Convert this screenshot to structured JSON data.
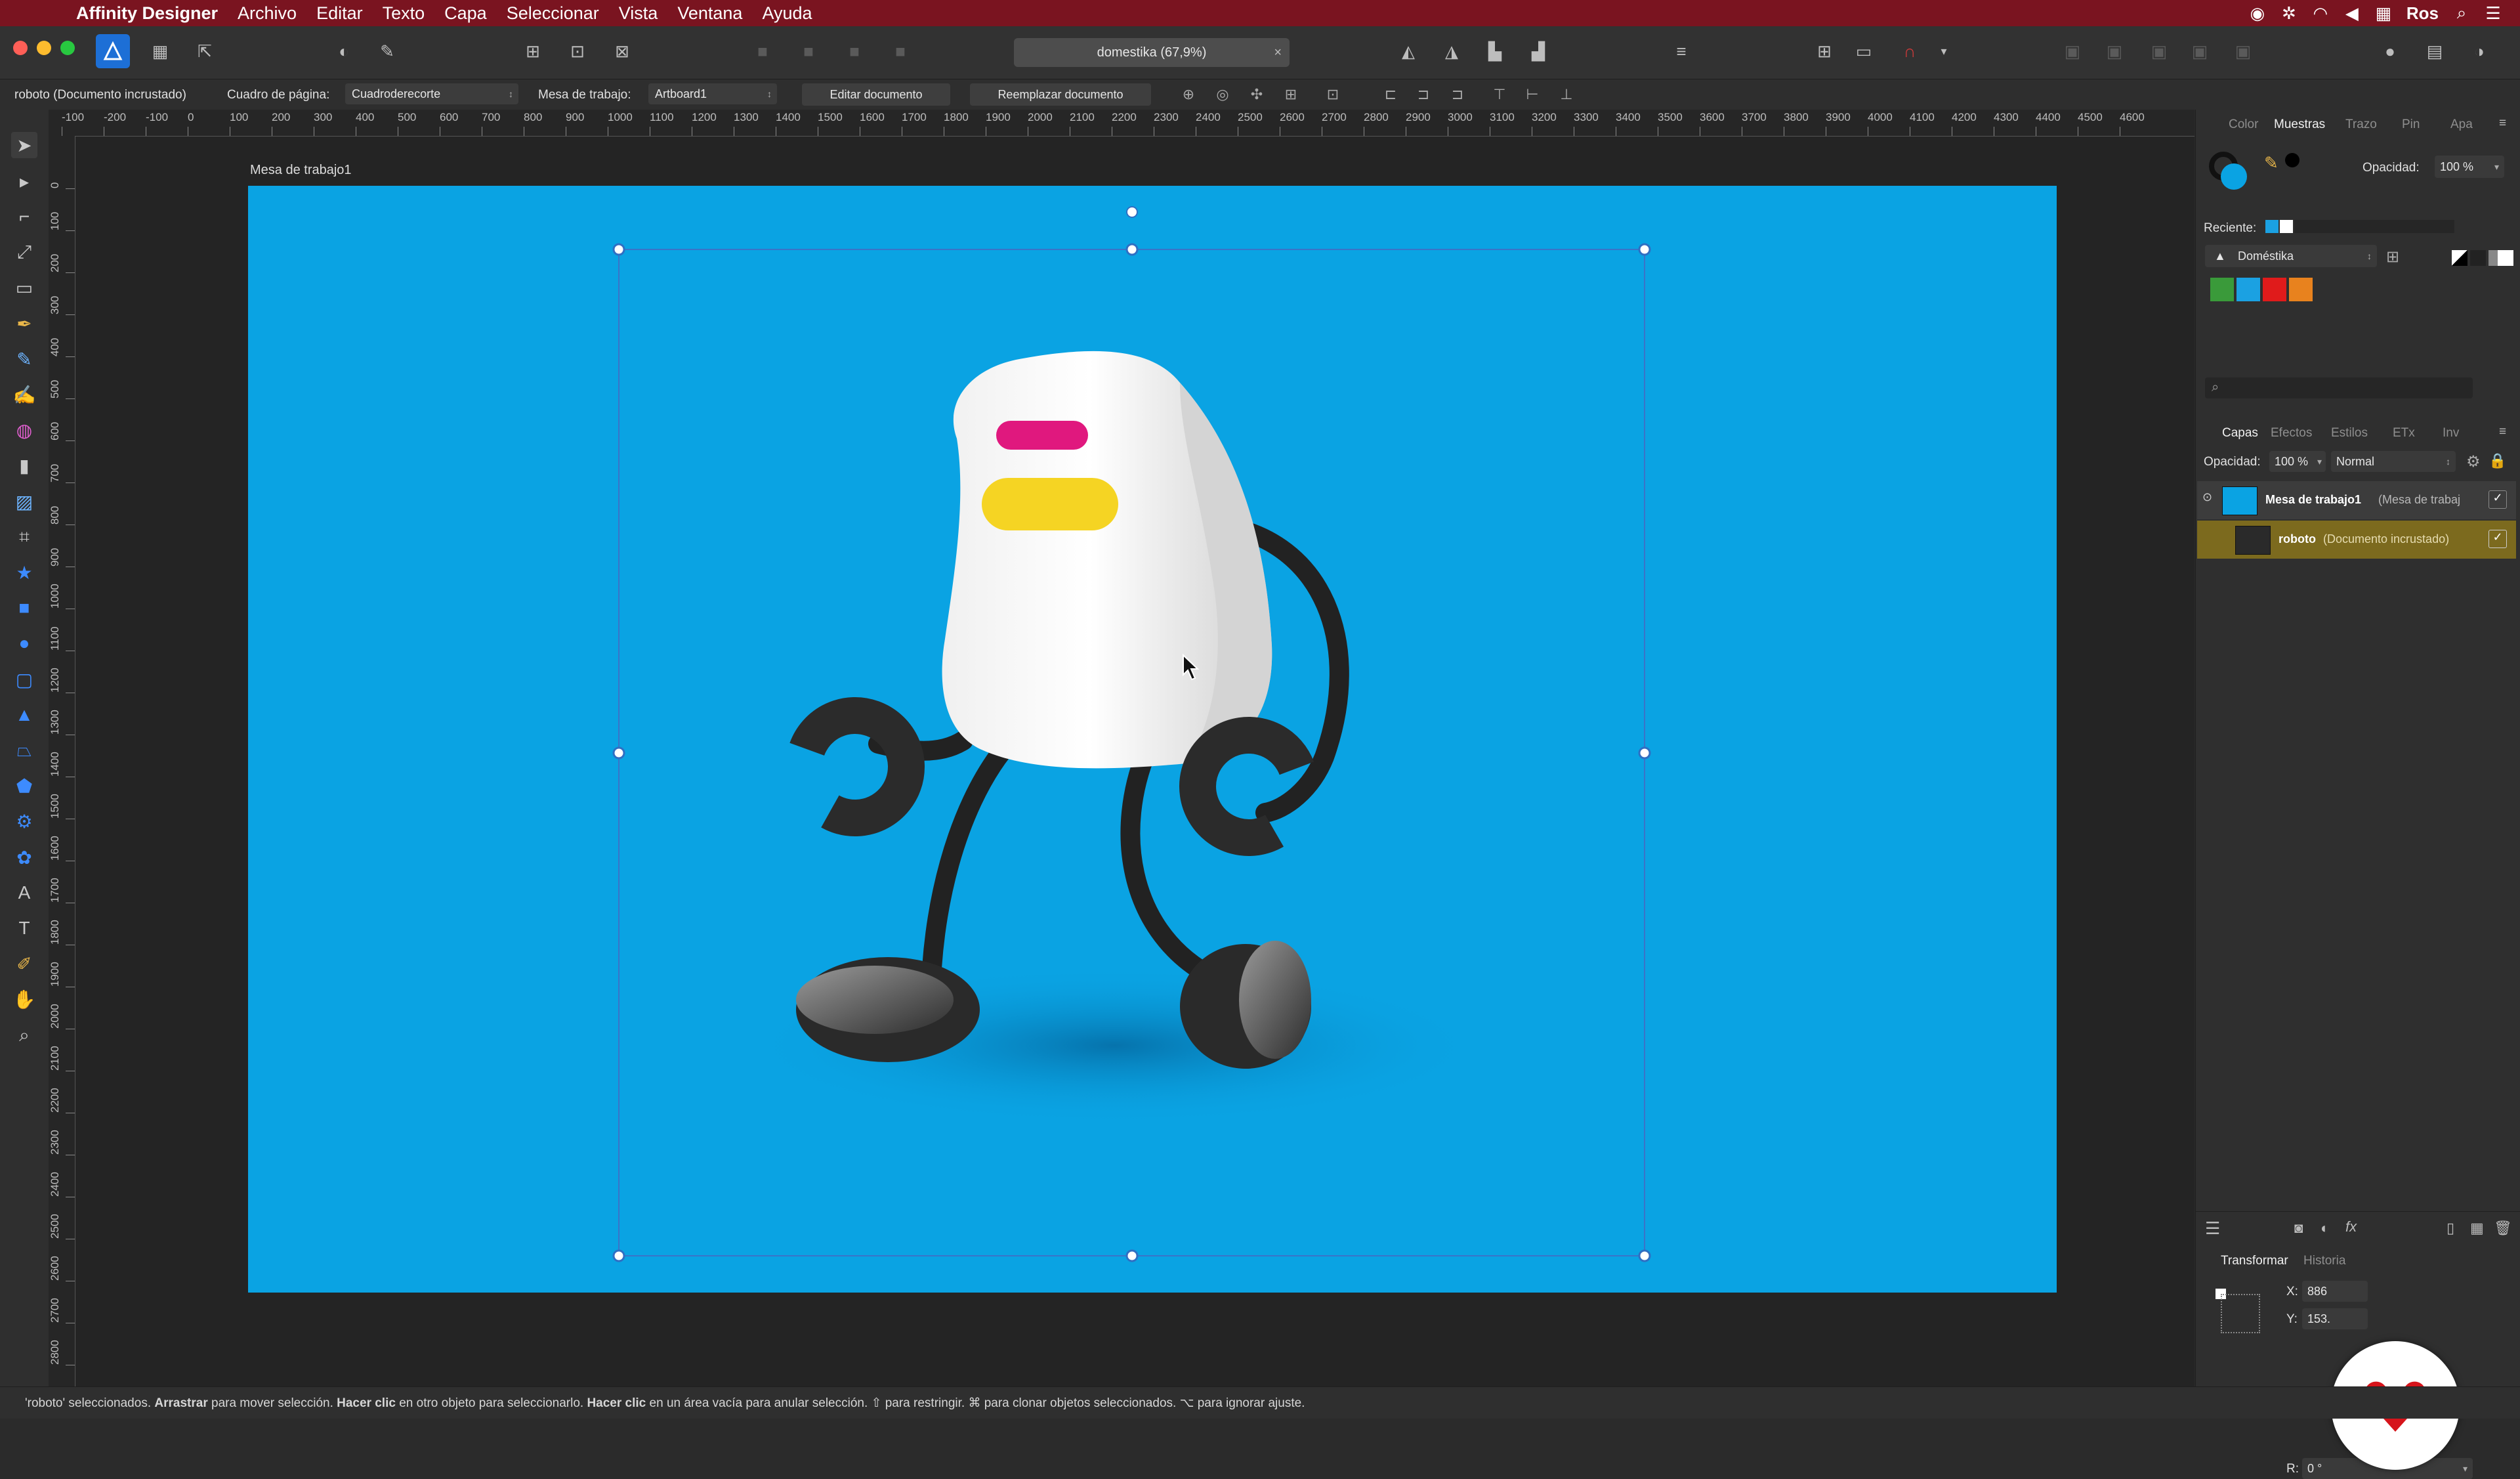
{
  "menubar": {
    "apple": "",
    "app_name": "Affinity Designer",
    "items": [
      "Archivo",
      "Editar",
      "Texto",
      "Capa",
      "Seleccionar",
      "Vista",
      "Ventana",
      "Ayuda"
    ],
    "user": "Ros",
    "bg_color": "#7a1420"
  },
  "toolbar": {
    "document_tab": "domestika (67,9%)",
    "close_glyph": "×"
  },
  "context_bar": {
    "selection_label": "roboto (Documento incrustado)",
    "page_box_label": "Cuadro de página:",
    "page_box_value": "Cuadroderecorte",
    "artboard_label": "Mesa de trabajo:",
    "artboard_value": "Artboard1",
    "edit_document": "Editar documento",
    "replace_document": "Reemplazar documento"
  },
  "ruler": {
    "top_labels": [
      "-100",
      "-200",
      "-100",
      "0",
      "100",
      "200",
      "300",
      "400",
      "500",
      "600",
      "700",
      "800",
      "900",
      "1000",
      "1100",
      "1200",
      "1300",
      "1400",
      "1500",
      "1600",
      "1700",
      "1800",
      "1900",
      "2000",
      "2100",
      "2200",
      "2300",
      "2400",
      "2500",
      "2600",
      "2700",
      "2800",
      "2900",
      "3000",
      "3100",
      "3200",
      "3300",
      "3400",
      "3500",
      "3600",
      "3700",
      "3800",
      "3900",
      "4000",
      "4100",
      "4200",
      "4300",
      "4400",
      "4500",
      "4600"
    ],
    "left_labels": [
      "0",
      "100",
      "200",
      "300",
      "400",
      "500",
      "600",
      "700",
      "800",
      "900",
      "1000",
      "1100",
      "1200",
      "1300",
      "1400",
      "1500",
      "1600",
      "1700",
      "1800",
      "1900",
      "2000",
      "2100",
      "2200",
      "2300",
      "2400",
      "2500",
      "2600",
      "2700",
      "2800"
    ]
  },
  "canvas": {
    "artboard_name": "Mesa de trabajo1",
    "artboard_color": "#0aa3e3"
  },
  "color_panel": {
    "tabs": [
      "Color",
      "Muestras",
      "Trazo",
      "Pin",
      "Apa"
    ],
    "active_tab": "Muestras",
    "opacity_label": "Opacidad:",
    "opacity_value": "100 %",
    "recent_label": "Reciente:",
    "palette_name": "Doméstika",
    "swatches": [
      "#3a9a3a",
      "#1ba1e2",
      "#e01b1b",
      "#e8821e"
    ],
    "search_placeholder": ""
  },
  "layers_panel": {
    "tabs": [
      "Capas",
      "Efectos",
      "Estilos",
      "ETx",
      "Inv"
    ],
    "active_tab": "Capas",
    "opacity_label": "Opacidad:",
    "opacity_value": "100 %",
    "blend_mode": "Normal",
    "layers": [
      {
        "name": "Mesa de trabajo1",
        "type": "(Mesa de trabaj",
        "checked": "✓"
      },
      {
        "name": "roboto",
        "type": "(Documento incrustado)",
        "checked": "✓"
      }
    ]
  },
  "transform_panel": {
    "tabs": [
      "Transformar",
      "Historia"
    ],
    "x_label": "X:",
    "x_value": "886",
    "y_label": "Y:",
    "y_value": "153.",
    "r_label": "R:",
    "r_value": "0 °"
  },
  "statusbar": {
    "parts": [
      {
        "t": "'roboto' seleccionados. ",
        "b": false
      },
      {
        "t": "Arrastrar",
        "b": true
      },
      {
        "t": " para mover selección. ",
        "b": false
      },
      {
        "t": "Hacer clic",
        "b": true
      },
      {
        "t": " en otro objeto para seleccionarlo. ",
        "b": false
      },
      {
        "t": "Hacer clic",
        "b": true
      },
      {
        "t": " en un área vacía para anular selección. ⇧ para restringir. ⌘ para clonar objetos seleccionados. ⌥ para ignorar ajuste.",
        "b": false
      }
    ]
  }
}
